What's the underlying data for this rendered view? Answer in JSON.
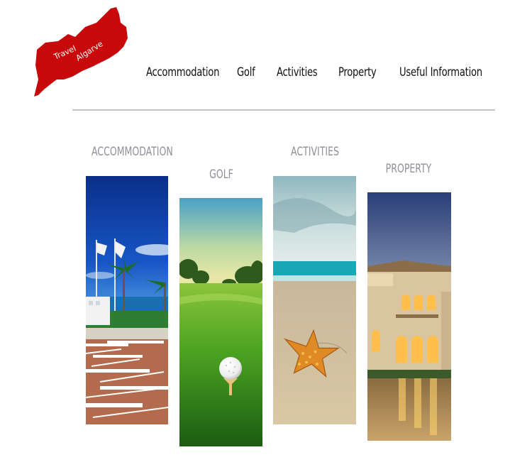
{
  "logo": {
    "line1": "Travel",
    "line2": "Algarve",
    "color": "#c8090c"
  },
  "nav": {
    "items": [
      {
        "label": "Accommodation"
      },
      {
        "label": "Golf"
      },
      {
        "label": "Activities"
      },
      {
        "label": "Property"
      },
      {
        "label": "Useful Information"
      }
    ]
  },
  "categories": [
    {
      "label": "ACCOMMODATION",
      "image": "resort-pool-palms-image"
    },
    {
      "label": "GOLF",
      "image": "golf-ball-on-tee-image"
    },
    {
      "label": "ACTIVITIES",
      "image": "starfish-beach-image"
    },
    {
      "label": "PROPERTY",
      "image": "villa-at-dusk-image"
    }
  ],
  "colors": {
    "label_gray": "#8e8f99",
    "rule_gray": "#c4c4c4",
    "text_dark": "#111111"
  }
}
